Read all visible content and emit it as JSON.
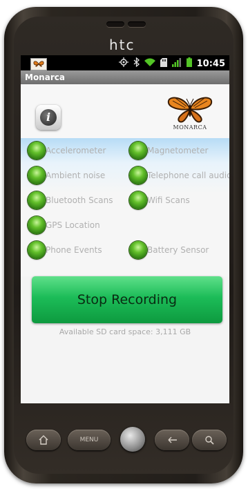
{
  "device": {
    "brand": "htc"
  },
  "status_bar": {
    "time": "10:45",
    "icons": [
      "gps-icon",
      "bluetooth-icon",
      "wifi-icon",
      "sdcard-icon",
      "signal-icon",
      "battery-icon"
    ]
  },
  "app": {
    "title": "Monarca",
    "logo_text": "MONARCA",
    "info_label": "i"
  },
  "sensors": [
    {
      "label": "Accelerometer",
      "status_color": "#4fb52a"
    },
    {
      "label": "Magnetometer",
      "status_color": "#4fb52a"
    },
    {
      "label": "Ambient noise",
      "status_color": "#4fb52a"
    },
    {
      "label": "Telephone call audio",
      "status_color": "#4fb52a"
    },
    {
      "label": "Bluetooth Scans",
      "status_color": "#4fb52a"
    },
    {
      "label": "Wifi Scans",
      "status_color": "#4fb52a"
    },
    {
      "label": "GPS Location",
      "status_color": "#4fb52a"
    },
    {
      "label": "Phone Events",
      "status_color": "#4fb52a"
    },
    {
      "label": "Battery Sensor",
      "status_color": "#4fb52a"
    }
  ],
  "stop_button": {
    "label": "Stop Recording",
    "color": "#1cbc58"
  },
  "storage": {
    "text": "Available SD card space: 3,111 GB"
  },
  "hardware_buttons": {
    "home": "home-icon",
    "menu": "MENU",
    "back": "back-icon",
    "search": "search-icon"
  }
}
